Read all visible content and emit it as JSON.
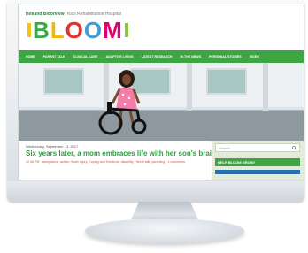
{
  "site": {
    "hospital_name": "Holland Bloorview",
    "hospital_sub": "Kids Rehabilitation Hospital",
    "logo_letters": [
      "B",
      "L",
      "O",
      "O",
      "M"
    ]
  },
  "nav": {
    "items": [
      "HOME",
      "PARENT TALK",
      "CLINICAL CARE",
      "ADAPTIVE LIVING",
      "LATEST RESEARCH",
      "IN THE NEWS",
      "PERSONAL STORIES",
      "VIDEO"
    ]
  },
  "post": {
    "date": "Wednesday, September 13, 2017",
    "title": "Six years later, a mom embraces life with her son's brain injury",
    "meta": "12:46 PM · acceptance, autism, Brain injury, Coping and Emotions, disability, Parent talk, parenting · 4 comments"
  },
  "sidebar": {
    "search_placeholder": "Search",
    "help_label": "HELP BLOOM GROW!"
  },
  "colors": {
    "brand_green": "#3da642",
    "title_green": "#2f9c3f",
    "meta_orange": "#d9542b"
  }
}
